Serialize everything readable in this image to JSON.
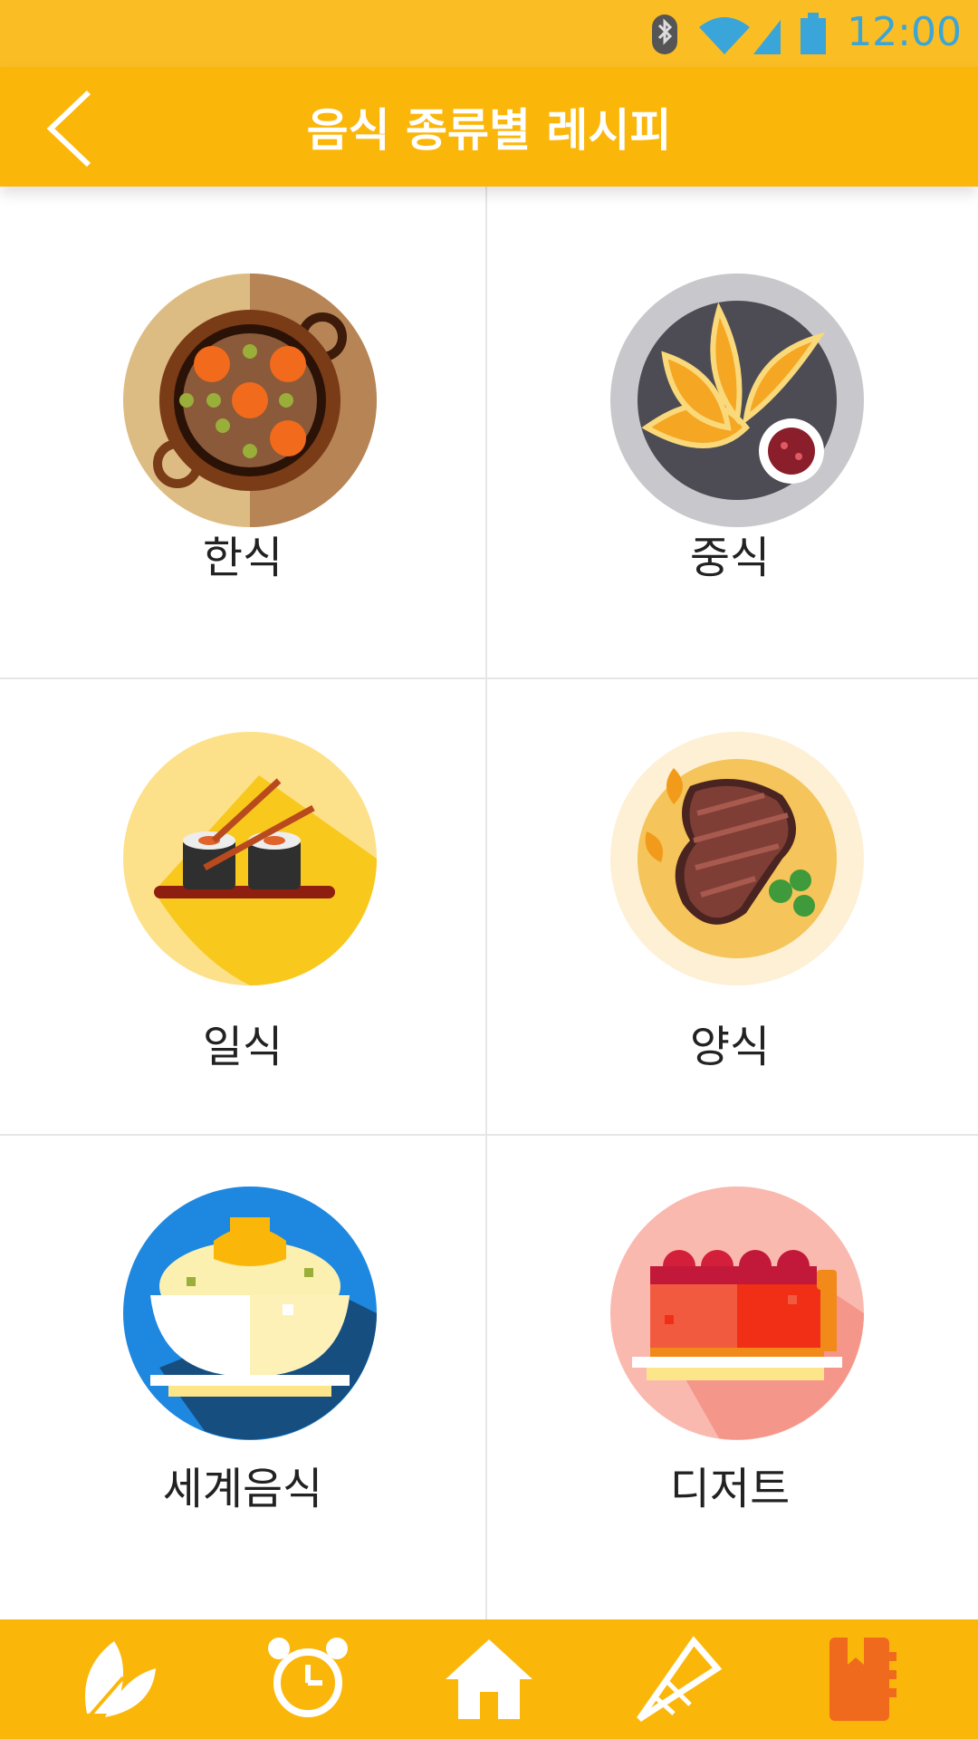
{
  "status_bar": {
    "time": "12:00",
    "icons": [
      "bluetooth-icon",
      "wifi-icon",
      "signal-icon",
      "battery-icon"
    ],
    "time_color": "#3AA5D8"
  },
  "header": {
    "back_icon": "chevron-left-icon",
    "title": "음식 종류별 레시피",
    "background": "#FBB60A"
  },
  "categories": [
    {
      "label": "한식",
      "icon": "korean-stew-pot-icon"
    },
    {
      "label": "중식",
      "icon": "dumplings-plate-icon"
    },
    {
      "label": "일식",
      "icon": "sushi-chopsticks-icon"
    },
    {
      "label": "양식",
      "icon": "steak-plate-icon"
    },
    {
      "label": "세계음식",
      "icon": "rice-bowl-icon"
    },
    {
      "label": "디저트",
      "icon": "cake-slice-icon"
    }
  ],
  "bottom_nav": {
    "items": [
      {
        "icon": "leaf-icon"
      },
      {
        "icon": "alarm-clock-icon"
      },
      {
        "icon": "home-icon"
      },
      {
        "icon": "party-hat-icon"
      },
      {
        "icon": "recipe-book-icon"
      }
    ]
  }
}
